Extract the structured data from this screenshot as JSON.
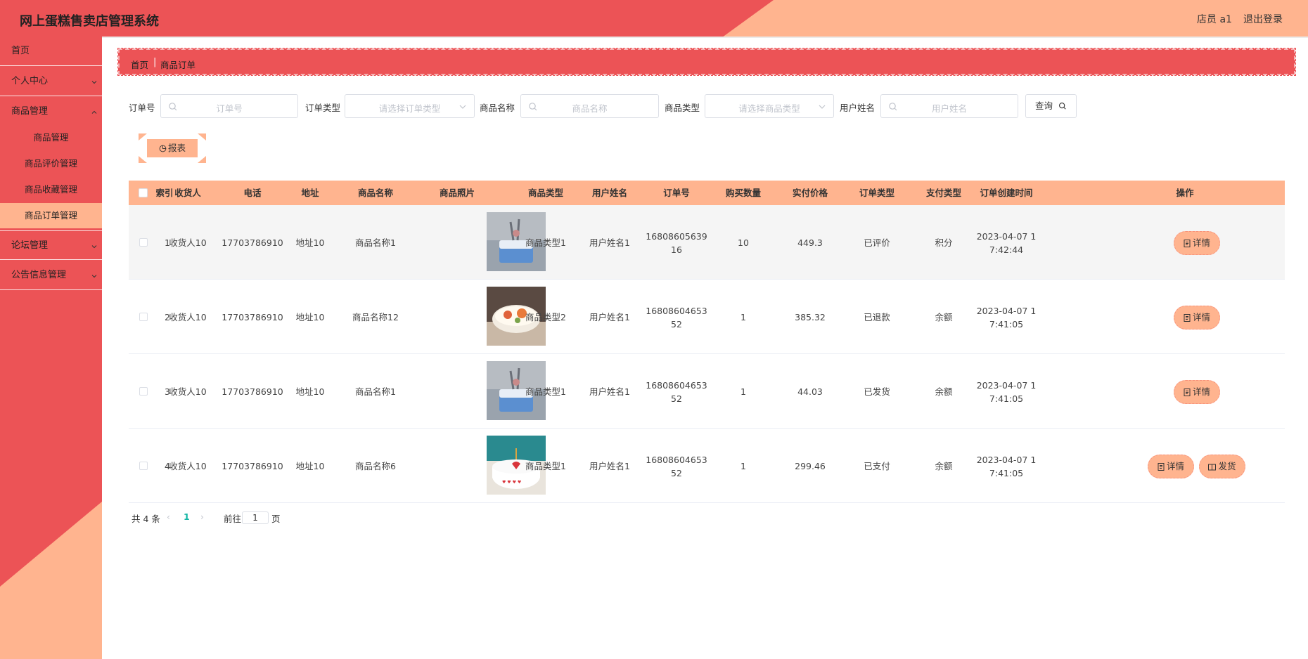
{
  "header": {
    "title": "网上蛋糕售卖店管理系统",
    "user": "店员 a1",
    "logout": "退出登录"
  },
  "sidebar": {
    "items": [
      {
        "label": "首页"
      },
      {
        "label": "个人中心"
      },
      {
        "label": "商品管理"
      },
      {
        "label": "论坛管理"
      },
      {
        "label": "公告信息管理"
      }
    ],
    "sub_items": [
      {
        "label": "商品管理"
      },
      {
        "label": "商品评价管理"
      },
      {
        "label": "商品收藏管理"
      },
      {
        "label": "商品订单管理",
        "active": true
      }
    ]
  },
  "breadcrumb": {
    "home": "首页",
    "current": "商品订单"
  },
  "search": {
    "order_no_label": "订单号",
    "order_no_placeholder": "订单号",
    "order_type_label": "订单类型",
    "order_type_placeholder": "请选择订单类型",
    "product_name_label": "商品名称",
    "product_name_placeholder": "商品名称",
    "product_type_label": "商品类型",
    "product_type_placeholder": "请选择商品类型",
    "user_name_label": "用户姓名",
    "user_name_placeholder": "用户姓名",
    "query_button": "查询"
  },
  "report_button": "报表",
  "table": {
    "columns": [
      "索引",
      "收货人",
      "电话",
      "地址",
      "商品名称",
      "商品照片",
      "商品类型",
      "用户姓名",
      "订单号",
      "购买数量",
      "实付价格",
      "订单类型",
      "支付类型",
      "订单创建时间",
      "操作"
    ],
    "rows": [
      {
        "index": "1",
        "receiver": "收货人10",
        "phone": "17703786910",
        "address": "地址10",
        "product": "商品名称1",
        "type": "商品类型1",
        "user": "用户姓名1",
        "order_no_1": "16808605639",
        "order_no_2": "16",
        "qty": "10",
        "price": "449.3",
        "order_type": "已评价",
        "pay_type": "积分",
        "time_1": "2023-04-07 1",
        "time_2": "7:42:44",
        "actions": [
          "详情"
        ]
      },
      {
        "index": "2",
        "receiver": "收货人10",
        "phone": "17703786910",
        "address": "地址10",
        "product": "商品名称12",
        "type": "商品类型2",
        "user": "用户姓名1",
        "order_no_1": "16808604653",
        "order_no_2": "52",
        "qty": "1",
        "price": "385.32",
        "order_type": "已退款",
        "pay_type": "余额",
        "time_1": "2023-04-07 1",
        "time_2": "7:41:05",
        "actions": [
          "详情"
        ]
      },
      {
        "index": "3",
        "receiver": "收货人10",
        "phone": "17703786910",
        "address": "地址10",
        "product": "商品名称1",
        "type": "商品类型1",
        "user": "用户姓名1",
        "order_no_1": "16808604653",
        "order_no_2": "52",
        "qty": "1",
        "price": "44.03",
        "order_type": "已发货",
        "pay_type": "余额",
        "time_1": "2023-04-07 1",
        "time_2": "7:41:05",
        "actions": [
          "详情"
        ]
      },
      {
        "index": "4",
        "receiver": "收货人10",
        "phone": "17703786910",
        "address": "地址10",
        "product": "商品名称6",
        "type": "商品类型1",
        "user": "用户姓名1",
        "order_no_1": "16808604653",
        "order_no_2": "52",
        "qty": "1",
        "price": "299.46",
        "order_type": "已支付",
        "pay_type": "余额",
        "time_1": "2023-04-07 1",
        "time_2": "7:41:05",
        "actions": [
          "详情",
          "发货"
        ]
      }
    ]
  },
  "pagination": {
    "total": "共 4 条",
    "page": "1",
    "goto": "前往",
    "page_unit": "页",
    "input_value": "1"
  },
  "colors": {
    "primary_red": "#ec5356",
    "accent_peach": "#ffb48f"
  }
}
